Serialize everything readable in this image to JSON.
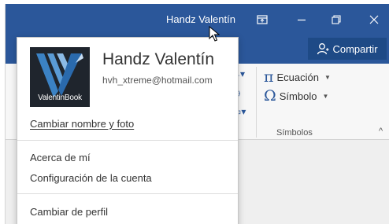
{
  "titlebar": {
    "user_name": "Handz Valentín",
    "buttons": [
      "ribbon-options",
      "minimize",
      "restore",
      "close"
    ]
  },
  "share": {
    "label": "Compartir",
    "icon": "person-icon"
  },
  "ribbon": {
    "equation_label": "Ecuación",
    "equation_glyph": "π",
    "symbol_label": "Símbolo",
    "symbol_glyph": "Ω",
    "group_label": "Símbolos",
    "collapse_glyph": "^"
  },
  "account": {
    "display_name": "Handz Valentín",
    "email": "hvh_xtreme@hotmail.com",
    "logo_text": "ValentinBook",
    "change_link": "Cambiar nombre y foto",
    "menu": [
      "Acerca de mí",
      "Configuración de la cuenta",
      "Cambiar de perfil"
    ]
  },
  "colors": {
    "title_bar": "#2b579a",
    "share_button": "#1e4a86",
    "logo_background": "#1f252d",
    "logo_stripes": "#3b82c4"
  }
}
